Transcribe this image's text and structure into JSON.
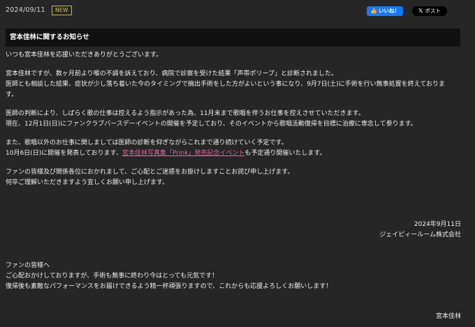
{
  "header": {
    "date": "2024/09/11",
    "new_badge": "NEW",
    "like_label": "いいね！",
    "post_label": "ポスト"
  },
  "article": {
    "title": "宮本佳林に関するお知らせ",
    "p1": "いつも宮本佳林を応援いただきありがとうございます。",
    "p2_l1": "宮本佳林ですが、数ヶ月前より喉の不調を訴えており、病院で診察を受けた結果「声帯ポリープ」と診断されました。",
    "p2_l2": "医師とも相談した結果、症状が少し落ち着いた今のタイミングで摘出手術をした方がよいという事になり、9月7日(土)に手術を行い無事処置を終えておりま",
    "p2_l3": "す。",
    "p3_l1": "医師の判断により、しばらく歌の仕事は控えるよう指示があった為、11月末まで歌唱を伴うお仕事を控えさせていただきます。",
    "p3_l2": "現在、12月1日(日)にファンクラブバースデーイベントの開催を予定しており、そのイベントから歌唱活動復帰を目標に治療に専念して参ります。",
    "p4_l1": "また、歌唱以外のお仕事に関しましては医師の診断を仰ぎながらこれまで通り続けていく予定です。",
    "p4_l2_pre": "10月6日(日)に開催を発表しております、",
    "p4_l2_link": "宮本佳林写真集「Prink」発売記念イベント",
    "p4_l2_post": "も予定通り開催いたします。",
    "p5_l1": "ファンの皆様及び関係各位におかれまして、ご心配とご迷惑をお掛けしますことお詫び申し上げます。",
    "p5_l2": "何卒ご理解いただきますよう宜しくお願い申し上げます。",
    "sign_date": "2024年9月11日",
    "sign_company": "ジェイピィールーム株式会社"
  },
  "fan_message": {
    "l1": "ファンの皆様へ",
    "l2": "ご心配おかけしておりますが、手術も無事に終わり今はとっても元気です！",
    "l3": "復帰後も素敵なパフォーマンスをお届けできるよう精一杯頑張りますので、これからも応援よろしくお願いします！",
    "signature": "宮本佳林"
  },
  "colors": {
    "background": "#262626",
    "title_bar": "#111111",
    "link": "#d96aa0",
    "facebook": "#1877f2",
    "badge": "#d9c45a"
  }
}
